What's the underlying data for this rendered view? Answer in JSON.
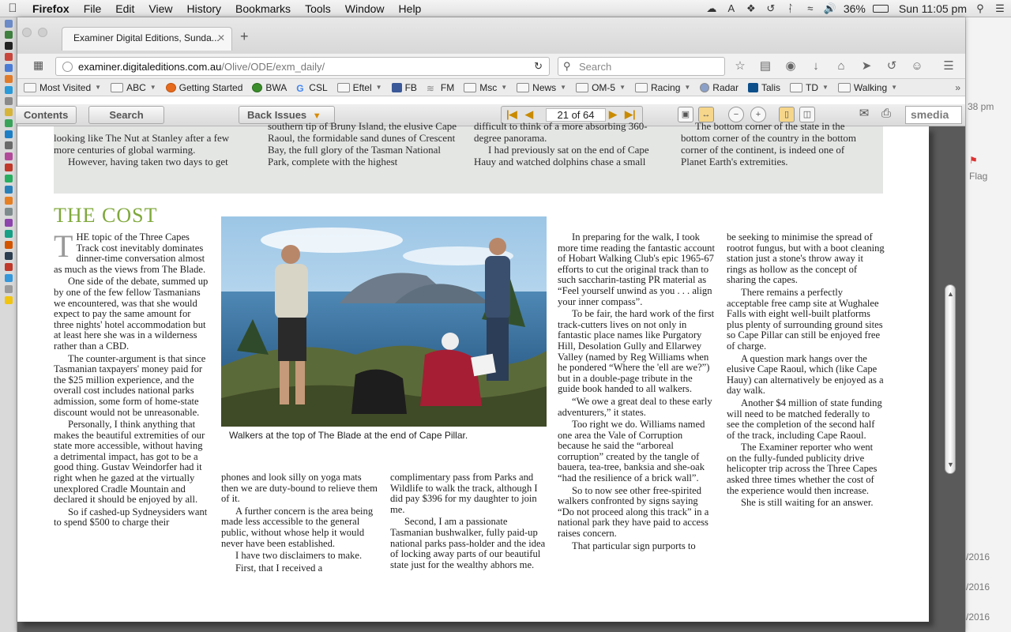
{
  "menubar": {
    "app": "Firefox",
    "items": [
      "File",
      "Edit",
      "View",
      "History",
      "Bookmarks",
      "Tools",
      "Window",
      "Help"
    ],
    "battery": "36%",
    "clock": "Sun 11:05 pm"
  },
  "browser": {
    "tab_title": "Examiner Digital Editions, Sunda...",
    "url_host": "examiner.digitaleditions.com.au",
    "url_path": "/Olive/ODE/exm_daily/",
    "search_placeholder": "Search"
  },
  "bookmarks": [
    {
      "label": "Most Visited",
      "dd": true
    },
    {
      "label": "ABC",
      "dd": true
    },
    {
      "label": "Getting Started",
      "dd": false
    },
    {
      "label": "BWA",
      "dd": false
    },
    {
      "label": "CSL",
      "dd": true
    },
    {
      "label": "Eftel",
      "dd": true
    },
    {
      "label": "FB",
      "dd": false
    },
    {
      "label": "FM",
      "dd": false
    },
    {
      "label": "Msc",
      "dd": true
    },
    {
      "label": "News",
      "dd": true
    },
    {
      "label": "OM-5",
      "dd": true
    },
    {
      "label": "Racing",
      "dd": true
    },
    {
      "label": "Radar",
      "dd": false
    },
    {
      "label": "Talis",
      "dd": false
    },
    {
      "label": "TD",
      "dd": true
    },
    {
      "label": "Walking",
      "dd": true
    }
  ],
  "reader": {
    "contents": "Contents",
    "search": "Search",
    "back_issues": "Back Issues",
    "page": "21 of 64",
    "brand": "smedia"
  },
  "background_window": {
    "time": "38 pm",
    "flag": "Flag",
    "dates": [
      "/2016",
      "/2016",
      "/2016"
    ]
  },
  "article": {
    "strip": [
      "looking like The Nut at Stanley after a few more centuries of global warming.",
      "However, having taken two days to get",
      "southern tip of Bruny Island, the elusive Cape Raoul, the formidable sand dunes of Crescent Bay, the full glory of the Tasman National Park, complete with the highest",
      "difficult to think of a more absorbing 360-degree panorama.",
      "I had previously sat on the end of Cape Hauy and watched dolphins chase a small",
      "The bottom corner of the state in the bottom corner of the country in the bottom corner of the continent, is indeed one of Planet Earth's extremities."
    ],
    "headline": "THE COST",
    "dropcap": "T",
    "col1": [
      "HE topic of the Three Capes Track cost inevitably dominates dinner-time conversation almost as much as the views from The Blade.",
      "One side of the debate, summed up by one of the few fellow Tasmanians we encountered, was that she would expect to pay the same amount for three nights' hotel accommodation but at least here she was in a wilderness rather than a CBD.",
      "The counter-argument is that since Tasmanian taxpayers' money paid for the $25 million experience, and the overall cost includes national parks admission, some form of home-state discount would not be unreasonable.",
      "Personally, I think anything that makes the beautiful extremities of our state more accessible, without having a detrimental impact, has got to be a good thing. Gustav Weindorfer had it right when he gazed at the virtually unexplored Cradle Mountain and declared it should be enjoyed by all.",
      "So if cashed-up Sydneysiders want to spend $500 to charge their"
    ],
    "caption": "Walkers at the top of The Blade at the end of Cape Pillar.",
    "col2": [
      "phones and look silly on yoga mats then we are duty-bound to relieve them of it.",
      "A further concern is the area being made less accessible to the general public, without whose help it would never have been established.",
      "I have two disclaimers to make.",
      "First, that I received a"
    ],
    "col3": [
      "complimentary pass from Parks and Wildlife to walk the track, although I did pay $396 for my daughter to join me.",
      "Second, I am a passionate Tasmanian bushwalker, fully paid-up national parks pass-holder and the idea of locking away parts of our beautiful state just for the wealthy abhors me."
    ],
    "col4": [
      "In preparing for the walk, I took more time reading the fantastic account of Hobart Walking Club's epic 1965-67 efforts to cut the original track than to such saccharin-tasting PR material as “Feel yourself unwind as you . . . align your inner compass”.",
      "To be fair, the hard work of the first track-cutters lives on not only in fantastic place names like Purgatory Hill, Desolation Gully and Ellarwey Valley (named by Reg Williams when he pondered “Where the 'ell are we?”) but in a double-page tribute in the guide book handed to all walkers.",
      "“We owe a great deal to these early adventurers,” it states.",
      "Too right we do. Williams named one area the Vale of Corruption because he said the “arboreal corruption” created by the tangle of bauera, tea-tree, banksia and she-oak “had the resilience of a brick wall”.",
      "So to now see other free-spirited walkers confronted by signs saying “Do not proceed along this track” in a national park they have paid to access raises concern.",
      "That particular sign purports to"
    ],
    "col5": [
      "be seeking to minimise the spread of rootrot fungus, but with a boot cleaning station just a stone's throw away it rings as hollow as the concept of sharing the capes.",
      "There remains a perfectly acceptable free camp site at Wughalee Falls with eight well-built platforms plus plenty of surrounding ground sites so Cape Pillar can still be enjoyed free of charge.",
      "A question mark hangs over the elusive Cape Raoul, which (like Cape Hauy) can alternatively be enjoyed as a day walk.",
      "Another $4 million of state funding will need to be matched federally to see the completion of the second half of the track, including Cape Raoul.",
      "The Examiner reporter who went on the fully-funded publicity drive helicopter trip across the Three Capes asked three times whether the cost of the experience would then increase.",
      "She is still waiting for an answer."
    ]
  }
}
